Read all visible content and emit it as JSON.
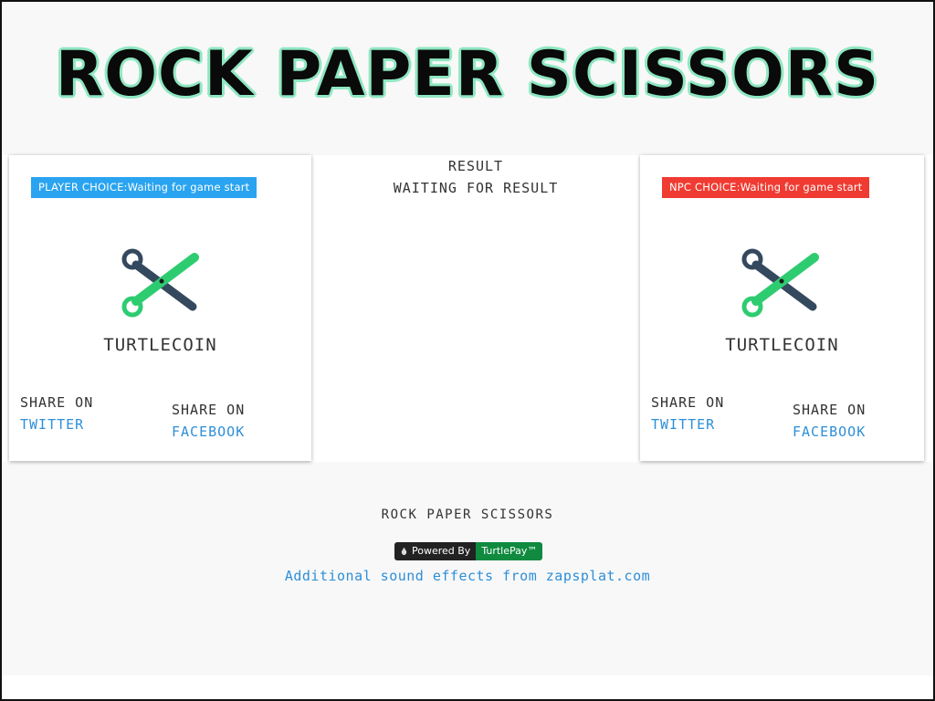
{
  "header": {
    "title": "ROCK PAPER SCISSORS"
  },
  "player": {
    "badge": "PLAYER CHOICE:Waiting for game start",
    "coin_label": "TURTLECOIN",
    "share_twitter_label": "SHARE ON",
    "share_twitter_link": "TWITTER",
    "share_facebook_label": "SHARE ON",
    "share_facebook_link": "FACEBOOK"
  },
  "result": {
    "label": "RESULT",
    "status": "WAITING FOR RESULT"
  },
  "npc": {
    "badge": "NPC CHOICE:Waiting for game start",
    "coin_label": "TURTLECOIN",
    "share_twitter_label": "SHARE ON",
    "share_twitter_link": "TWITTER",
    "share_facebook_label": "SHARE ON",
    "share_facebook_link": "FACEBOOK"
  },
  "footer": {
    "title": "ROCK PAPER SCISSORS",
    "powered_by": "Powered By",
    "powered_brand": "TurtlePay™",
    "sound_credit": "Additional sound effects from zapsplat.com"
  },
  "colors": {
    "player_badge": "#2aa4f0",
    "npc_badge": "#f03b32",
    "link": "#2d8fd8",
    "title_outline": "#8fe7c2",
    "scissors_green": "#2ecc71",
    "scissors_dark": "#34495e"
  },
  "icons": {
    "choice_icon": "scissors-icon",
    "powered_icon": "turtle-icon"
  }
}
